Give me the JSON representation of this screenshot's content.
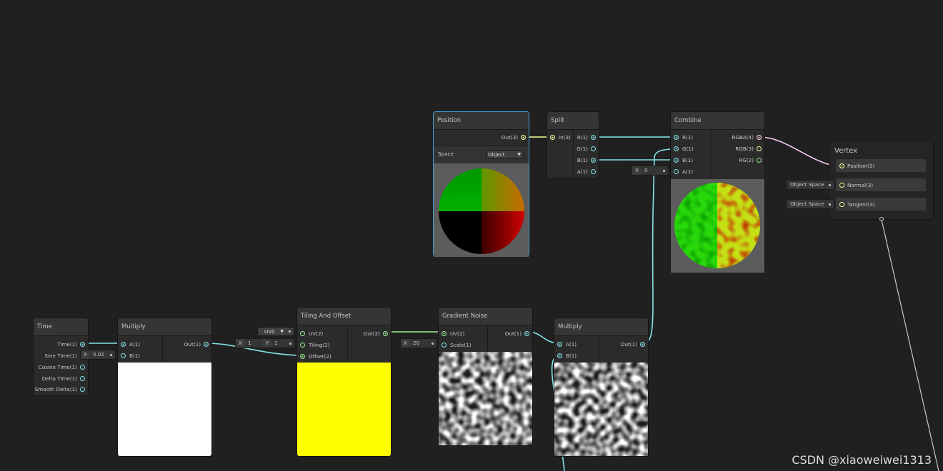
{
  "watermark": "CSDN @xiaoweiwei1313",
  "colors": {
    "background": "#202020",
    "wire_float": "#84e4e7",
    "wire_vec3": "#f6ff9a",
    "wire_vec2": "#9aef92",
    "wire_vec4": "#fbcbf4",
    "selection": "#44a0d8",
    "yellow_preview": "#ffff00"
  },
  "nodes": {
    "time": {
      "title": "Time",
      "outputs": [
        "Time(1)",
        "Sine Time(1)",
        "Cosine Time(1)",
        "Delta Time(1)",
        "Smooth Delta(1)"
      ]
    },
    "multiply1": {
      "title": "Multiply",
      "inputs": [
        "A(1)",
        "B(1)"
      ],
      "output": "Out(1)",
      "b_axis": "X",
      "b_value": "0.02"
    },
    "tiling": {
      "title": "Tiling And Offset",
      "inputs": [
        "UV(2)",
        "Tiling(2)",
        "Offset(2)"
      ],
      "output": "Out(2)",
      "uv_value": "UV0",
      "tiling_x_axis": "X",
      "tiling_x": "1",
      "tiling_y_axis": "Y",
      "tiling_y": "1"
    },
    "gradient_noise": {
      "title": "Gradient Noise",
      "inputs": [
        "UV(2)",
        "Scale(1)"
      ],
      "output": "Out(1)",
      "scale_axis": "X",
      "scale_value": "20"
    },
    "multiply2": {
      "title": "Multiply",
      "inputs": [
        "A(1)",
        "B(1)"
      ],
      "output": "Out(1)"
    },
    "position": {
      "title": "Position",
      "output": "Out(3)",
      "space_label": "Space",
      "space_value": "Object"
    },
    "split": {
      "title": "Split",
      "input": "In(3)",
      "outputs": [
        "R(1)",
        "G(1)",
        "B(1)",
        "A(1)"
      ]
    },
    "combine": {
      "title": "Combine",
      "inputs": [
        "R(1)",
        "G(1)",
        "B(1)",
        "A(1)"
      ],
      "outputs": [
        "RGBA(4)",
        "RGB(3)",
        "RG(2)"
      ],
      "a_axis": "X",
      "a_value": "0"
    },
    "vertex": {
      "title": "Vertex",
      "slots": [
        "Position(3)",
        "Normal(3)",
        "Tangent(3)"
      ],
      "normal_space": "Object Space",
      "tangent_space": "Object Space"
    }
  }
}
